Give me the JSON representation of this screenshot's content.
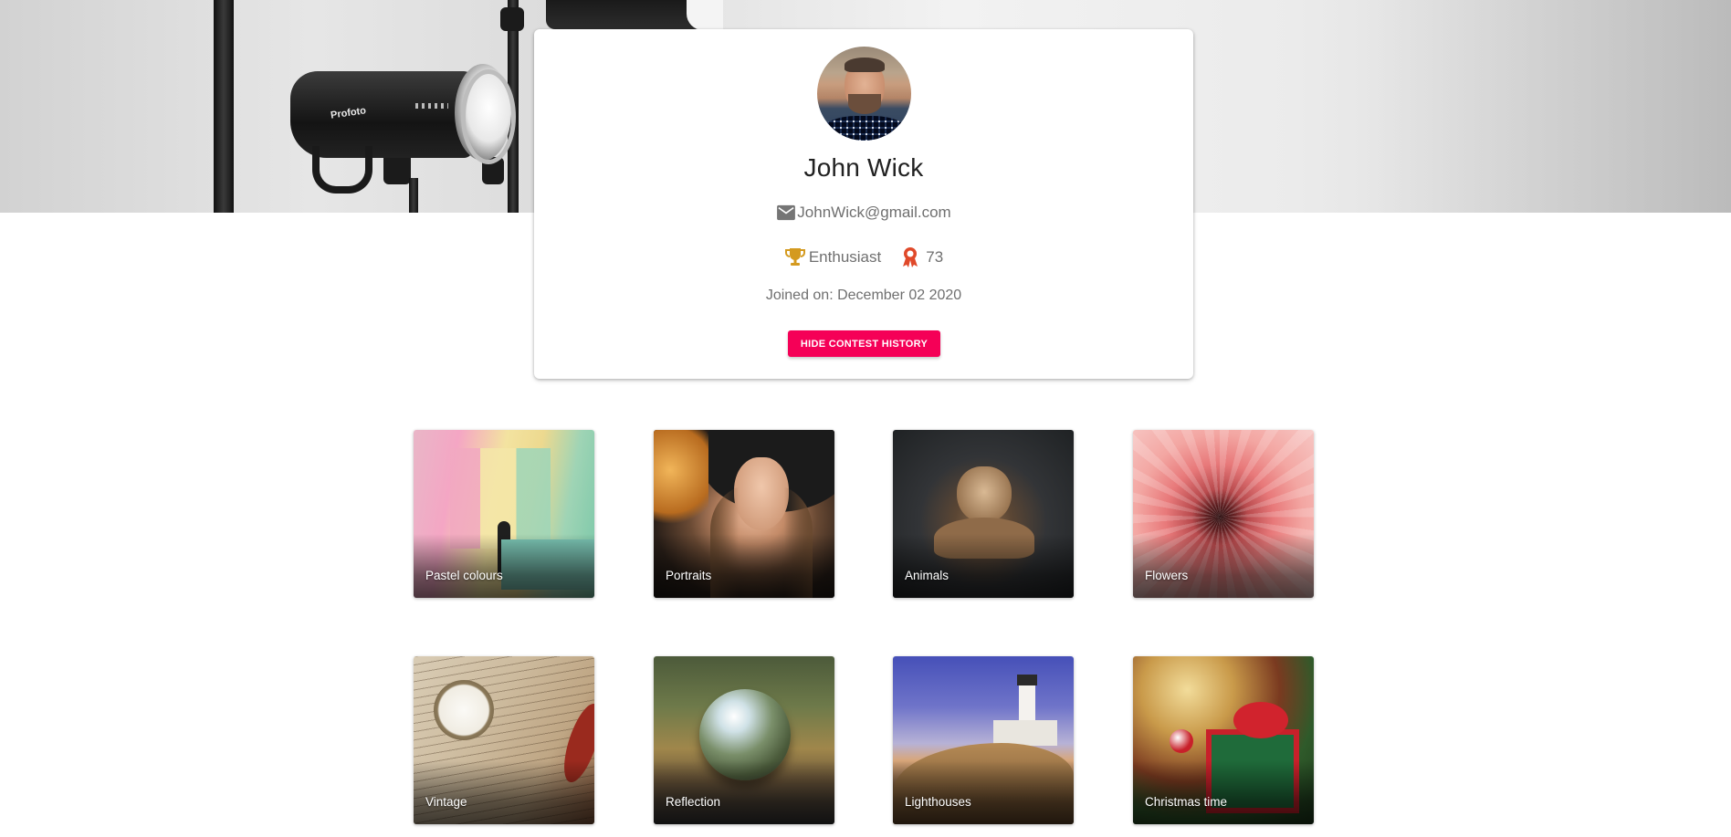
{
  "profile": {
    "name": "John Wick",
    "email": "JohnWick@gmail.com",
    "rank": "Enthusiast",
    "points": "73",
    "joined": "Joined on: December 02 2020",
    "hide_button": "HIDE CONTEST HISTORY"
  },
  "hero": {
    "brand_text": "Profoto"
  },
  "categories": [
    {
      "label": "Pastel colours"
    },
    {
      "label": "Portraits"
    },
    {
      "label": "Animals"
    },
    {
      "label": "Flowers"
    },
    {
      "label": "Vintage"
    },
    {
      "label": "Reflection"
    },
    {
      "label": "Lighthouses"
    },
    {
      "label": "Christmas time"
    }
  ],
  "colors": {
    "accent": "#f50057",
    "trophy": "#d49a1f",
    "medal": "#e0492a",
    "text_primary": "#212121",
    "text_secondary": "#6f6f6f"
  },
  "icons": {
    "email": "mail-icon",
    "rank": "trophy-icon",
    "points": "medal-icon"
  }
}
